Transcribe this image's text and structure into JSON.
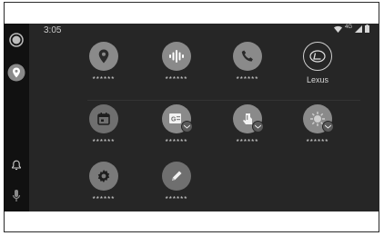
{
  "status": {
    "time": "3:05",
    "network": "4G"
  },
  "rail": {
    "items": [
      {
        "icon": "home-circle-icon"
      },
      {
        "icon": "map-pin-icon"
      },
      {
        "icon": "bell-icon"
      },
      {
        "icon": "microphone-icon"
      }
    ]
  },
  "apps": [
    {
      "label": "******",
      "icon": "maps-pin-icon",
      "color": "#8a8a8a"
    },
    {
      "label": "******",
      "icon": "podcast-icon",
      "color": "#8a8a8a"
    },
    {
      "label": "******",
      "icon": "phone-icon",
      "color": "#8a8a8a"
    },
    {
      "label": "Lexus",
      "icon": "lexus-logo-icon",
      "color": "#262626"
    },
    {
      "label": "******",
      "icon": "calendar-icon",
      "color": "#6f6f6f"
    },
    {
      "label": "******",
      "icon": "news-icon",
      "color": "#8a8a8a"
    },
    {
      "label": "******",
      "icon": "assistant-hand-icon",
      "color": "#8a8a8a"
    },
    {
      "label": "******",
      "icon": "weather-icon",
      "color": "#8a8a8a"
    },
    {
      "label": "******",
      "icon": "settings-gear-icon",
      "color": "#7a7a7a"
    },
    {
      "label": "******",
      "icon": "pencil-icon",
      "color": "#6f6f6f"
    }
  ]
}
